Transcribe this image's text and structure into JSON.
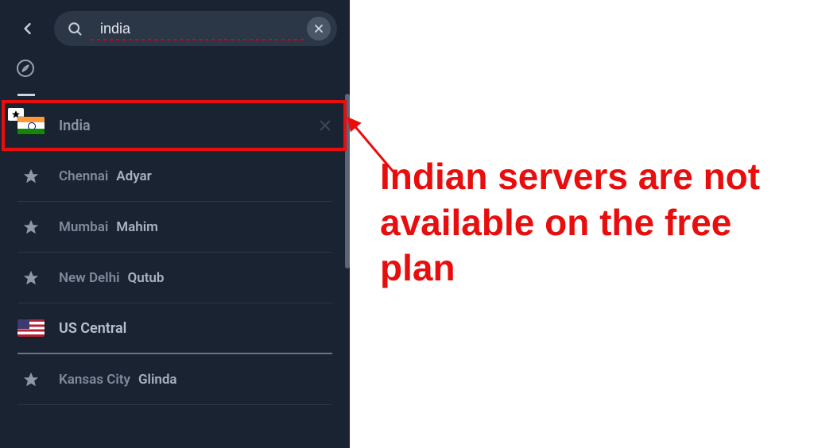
{
  "search": {
    "value": "india",
    "placeholder": ""
  },
  "results": {
    "country_header": {
      "label": "India",
      "flag": "india"
    },
    "cities": [
      {
        "city": "Chennai",
        "server": "Adyar"
      },
      {
        "city": "Mumbai",
        "server": "Mahim"
      },
      {
        "city": "New Delhi",
        "server": "Qutub"
      }
    ],
    "region_header": {
      "label": "US Central",
      "flag": "us"
    },
    "region_cities": [
      {
        "city": "Kansas City",
        "server": "Glinda"
      }
    ]
  },
  "annotation": {
    "text": "Indian servers are not available on the free plan",
    "color": "#e90e0e"
  }
}
